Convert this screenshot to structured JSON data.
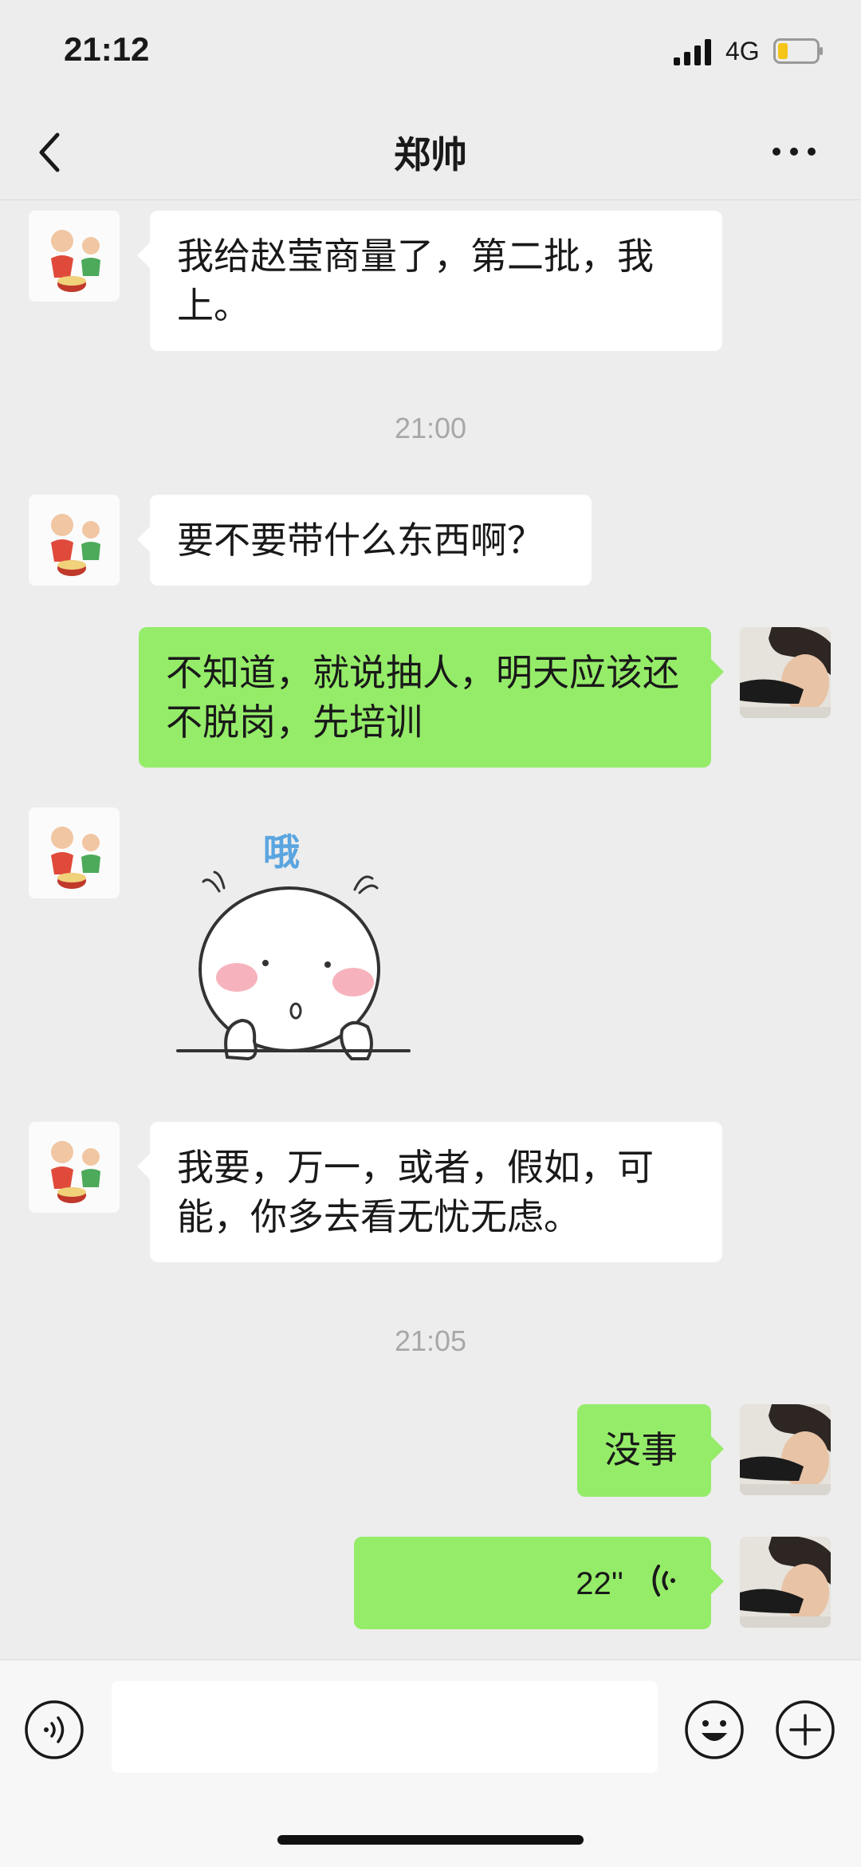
{
  "status_bar": {
    "time": "21:12",
    "network": "4G"
  },
  "nav": {
    "title": "郑帅"
  },
  "messages": [
    {
      "text": "我给赵莹商量了，第二批，我上。"
    },
    {
      "text": "要不要带什么东西啊？"
    },
    {
      "text": "不知道，就说抽人，明天应该还不脱岗，先培训"
    },
    {
      "sticker_text": "哦"
    },
    {
      "text": "我要，万一，或者，假如，可能，你多去看无忧无虑。"
    },
    {
      "text": "没事"
    },
    {
      "voice_duration": "22''"
    }
  ],
  "timestamps": [
    "21:00",
    "21:05"
  ],
  "colors": {
    "background": "#ededed",
    "incoming_bubble": "#ffffff",
    "outgoing_bubble": "#95ec69",
    "timestamp_text": "#a8a8a8"
  },
  "icons": [
    "back-icon",
    "more-icon",
    "voice-wave-icon",
    "voice-input-icon",
    "emoji-icon",
    "plus-icon"
  ]
}
